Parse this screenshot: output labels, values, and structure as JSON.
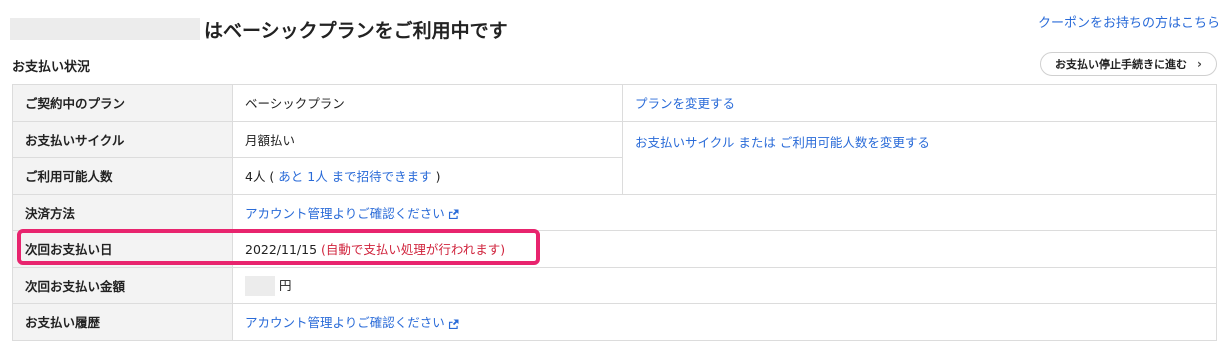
{
  "header": {
    "plan_title": "はベーシックプランをご利用中です",
    "coupon_link": "クーポンをお持ちの方はこちら"
  },
  "section": {
    "title": "お支払い状況",
    "stop_button": "お支払い停止手続きに進む",
    "chevron": "›"
  },
  "rows": {
    "plan": {
      "label": "ご契約中のプラン",
      "value": "ベーシックプラン",
      "action": "プランを変更する"
    },
    "cycle": {
      "label": "お支払いサイクル",
      "value": "月額払い",
      "action": "お支払いサイクル または ご利用可能人数を変更する"
    },
    "seats": {
      "label": "ご利用可能人数",
      "value_prefix": "4人 ( ",
      "value_link": "あと 1人 まで招待できます",
      "value_suffix": " )"
    },
    "method": {
      "label": "決済方法",
      "value": "アカウント管理よりご確認ください"
    },
    "next_date": {
      "label": "次回お支払い日",
      "date": "2022/11/15",
      "note": "(自動で支払い処理が行われます)"
    },
    "next_amount": {
      "label": "次回お支払い金額",
      "unit": "円"
    },
    "history": {
      "label": "お支払い履歴",
      "value": "アカウント管理よりご確認ください"
    }
  },
  "colors": {
    "link": "#2a6bd8",
    "highlight": "#e8246e",
    "warning": "#d0243d"
  },
  "icons": {
    "external_link": "external-link-icon"
  }
}
